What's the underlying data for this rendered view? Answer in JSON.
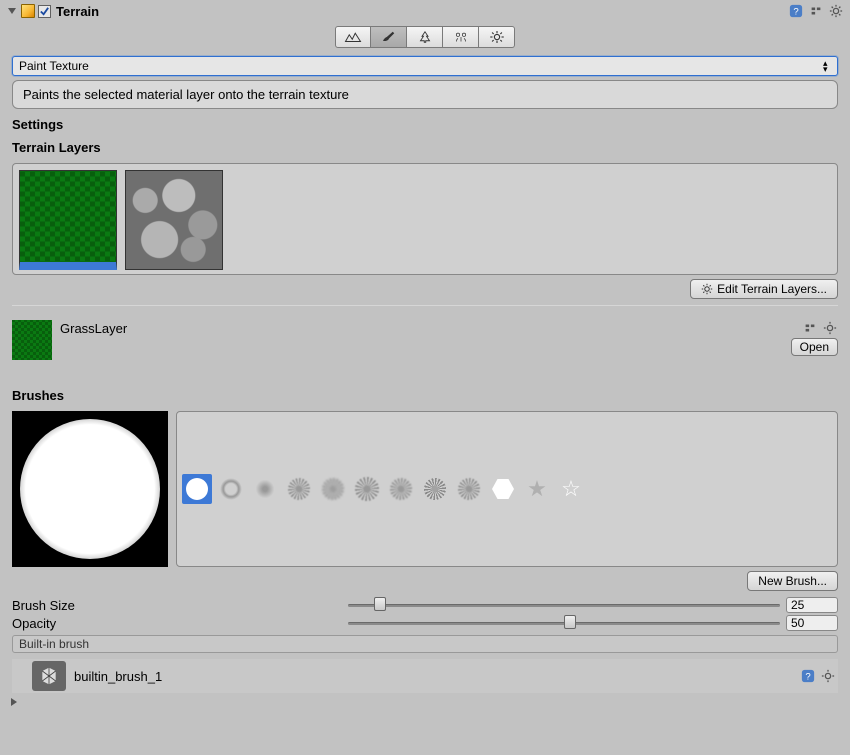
{
  "header": {
    "title": "Terrain",
    "enabled": true
  },
  "modes": {
    "selected_index": 1,
    "items": [
      "raise-lower",
      "paint-texture",
      "paint-trees",
      "paint-details",
      "settings"
    ]
  },
  "tool_dropdown": {
    "value": "Paint Texture"
  },
  "description": "Paints the selected material layer onto the terrain texture",
  "sections": {
    "settings": "Settings",
    "terrain_layers": "Terrain Layers",
    "brushes": "Brushes"
  },
  "layers": {
    "items": [
      "grass",
      "rocks"
    ],
    "selected_index": 0,
    "edit_button": "Edit Terrain Layers..."
  },
  "selected_layer": {
    "name": "GrassLayer",
    "open_button": "Open"
  },
  "brushes": {
    "selected_index": 0,
    "new_brush_button": "New Brush...",
    "items": [
      "hard-circle",
      "soft-ring",
      "soft-dot",
      "speckle-1",
      "speckle-2",
      "speckle-3",
      "speckle-4",
      "speckle-5",
      "speckle-6",
      "hexagon",
      "star-filled",
      "star-outline"
    ]
  },
  "sliders": {
    "brush_size": {
      "label": "Brush Size",
      "value": "25",
      "pos_pct": 6
    },
    "opacity": {
      "label": "Opacity",
      "value": "50",
      "pos_pct": 50
    }
  },
  "brush_source": "Built-in brush",
  "asset": {
    "name": "builtin_brush_1"
  }
}
